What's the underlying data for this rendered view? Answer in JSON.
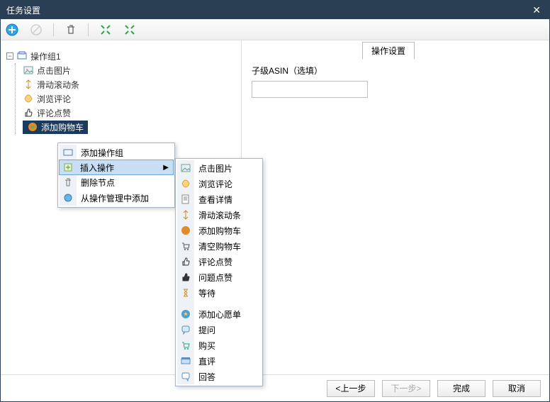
{
  "titlebar": {
    "title": "任务设置",
    "close": "✕"
  },
  "tab": {
    "label": "操作设置"
  },
  "tree": {
    "root": "操作组1",
    "items": [
      {
        "icon": "image-icon",
        "label": "点击图片"
      },
      {
        "icon": "scroll-icon",
        "label": "滑动滚动条"
      },
      {
        "icon": "browse-icon",
        "label": "浏览评论"
      },
      {
        "icon": "thumb-icon",
        "label": "评论点赞"
      },
      {
        "icon": "cart-icon",
        "label": "添加购物车"
      }
    ]
  },
  "ctx": {
    "items": [
      {
        "icon": "group-icon",
        "label": "添加操作组"
      },
      {
        "icon": "insert-icon",
        "label": "插入操作",
        "hasSub": true
      },
      {
        "icon": "delete-icon",
        "label": "删除节点"
      },
      {
        "icon": "manage-icon",
        "label": "从操作管理中添加"
      }
    ]
  },
  "sub": {
    "items": [
      {
        "icon": "image-icon",
        "label": "点击图片"
      },
      {
        "icon": "browse-icon",
        "label": "浏览评论"
      },
      {
        "icon": "detail-icon",
        "label": "查看详情"
      },
      {
        "icon": "scroll-icon",
        "label": "滑动滚动条"
      },
      {
        "icon": "cart-add-icon",
        "label": "添加购物车"
      },
      {
        "icon": "cart-clear-icon",
        "label": "清空购物车"
      },
      {
        "icon": "thumb-icon",
        "label": "评论点赞"
      },
      {
        "icon": "thumb2-icon",
        "label": "问题点赞"
      },
      {
        "icon": "wait-icon",
        "label": "等待"
      },
      {
        "icon": "wish-icon",
        "label": "添加心愿单"
      },
      {
        "icon": "ask-icon",
        "label": "提问"
      },
      {
        "icon": "buy-icon",
        "label": "购买"
      },
      {
        "icon": "review-icon",
        "label": "直评"
      },
      {
        "icon": "answer-icon",
        "label": "回答"
      }
    ]
  },
  "right": {
    "label": "子级ASIN（选填）",
    "value": ""
  },
  "footer": {
    "prev": "<上一步",
    "next": "下一步>",
    "finish": "完成",
    "cancel": "取消"
  }
}
